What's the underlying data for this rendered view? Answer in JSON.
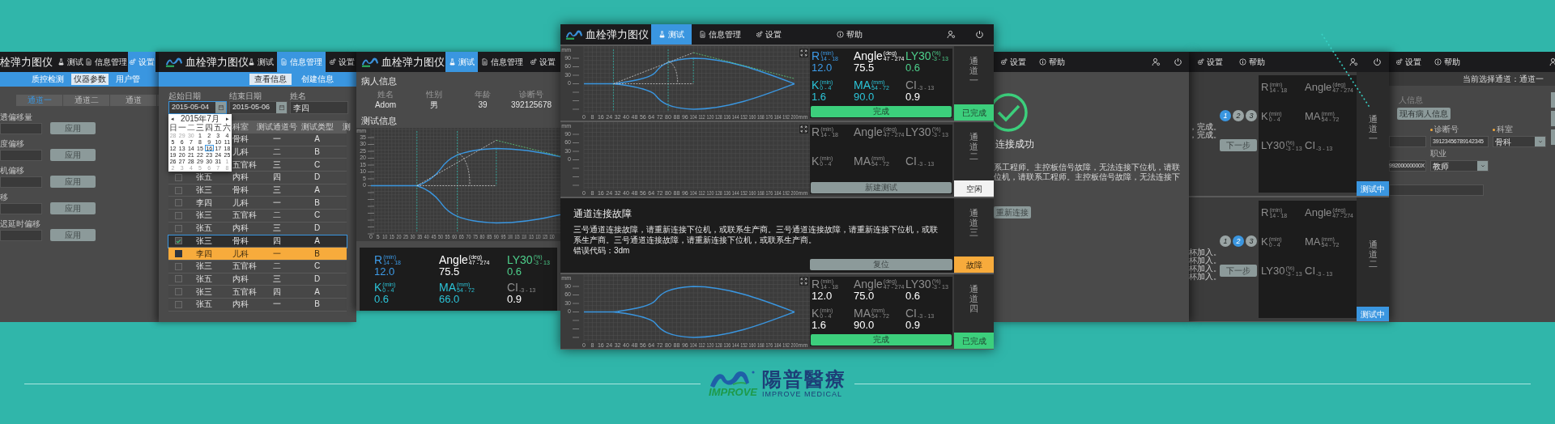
{
  "settings_window": {
    "title": "栓弹力图仪",
    "tabs": [
      {
        "label": "测试",
        "kind": "test",
        "selected": false
      },
      {
        "label": "信息管理",
        "kind": "records",
        "selected": false
      },
      {
        "label": "设置",
        "kind": "settings",
        "selected": true
      }
    ],
    "subtabs": [
      {
        "label": "质控检测",
        "selected": false
      },
      {
        "label": "仪器参数",
        "selected": true
      },
      {
        "label": "用户管",
        "selected": false
      }
    ],
    "channel_tabs": [
      {
        "label": "通道一",
        "selected": true
      },
      {
        "label": "通道二",
        "selected": false
      },
      {
        "label": "通道",
        "selected": false
      }
    ],
    "params": [
      {
        "label": "透偏移量",
        "button": "应用"
      },
      {
        "label": "度偏移",
        "button": "应用"
      },
      {
        "label": "机偏移",
        "button": "应用"
      },
      {
        "label": "移",
        "button": "应用"
      },
      {
        "label": "迟延时偏移",
        "button": "应用"
      }
    ]
  },
  "records_window": {
    "title": "血栓弹力图仪",
    "tabs": [
      {
        "label": "测试",
        "kind": "test",
        "selected": false
      },
      {
        "label": "信息管理",
        "kind": "records",
        "selected": true
      },
      {
        "label": "设置",
        "kind": "settings",
        "selected": false
      }
    ],
    "subtabs": [
      {
        "label": "查看信息",
        "selected": true
      },
      {
        "label": "创建信息",
        "selected": false
      }
    ],
    "filters": [
      {
        "label": "起始日期",
        "value": "2015-05-04",
        "kind": "date",
        "focused": true
      },
      {
        "label": "结束日期",
        "value": "2015-05-06",
        "kind": "date",
        "focused": false
      },
      {
        "label": "姓名",
        "value": "李四",
        "kind": "text",
        "focused": false
      }
    ],
    "calendar": {
      "title": "2015年7月",
      "prev": "◂",
      "next": "▸",
      "weekdays": [
        "日",
        "一",
        "二",
        "三",
        "四",
        "五",
        "六"
      ],
      "days": [
        {
          "day": "28",
          "muted": true,
          "selected": false
        },
        {
          "day": "29",
          "muted": true,
          "selected": false
        },
        {
          "day": "30",
          "muted": true,
          "selected": false
        },
        {
          "day": "1",
          "muted": false,
          "selected": false
        },
        {
          "day": "2",
          "muted": false,
          "selected": false
        },
        {
          "day": "3",
          "muted": false,
          "selected": false
        },
        {
          "day": "4",
          "muted": false,
          "selected": false
        },
        {
          "day": "5",
          "muted": false,
          "selected": false
        },
        {
          "day": "6",
          "muted": false,
          "selected": false
        },
        {
          "day": "7",
          "muted": false,
          "selected": false
        },
        {
          "day": "8",
          "muted": false,
          "selected": false
        },
        {
          "day": "9",
          "muted": false,
          "selected": false
        },
        {
          "day": "10",
          "muted": false,
          "selected": false
        },
        {
          "day": "11",
          "muted": false,
          "selected": false
        },
        {
          "day": "12",
          "muted": false,
          "selected": false
        },
        {
          "day": "13",
          "muted": false,
          "selected": false
        },
        {
          "day": "14",
          "muted": false,
          "selected": false
        },
        {
          "day": "15",
          "muted": false,
          "selected": false
        },
        {
          "day": "16",
          "muted": false,
          "selected": true
        },
        {
          "day": "17",
          "muted": false,
          "selected": false
        },
        {
          "day": "18",
          "muted": false,
          "selected": false
        },
        {
          "day": "19",
          "muted": false,
          "selected": false
        },
        {
          "day": "20",
          "muted": false,
          "selected": false
        },
        {
          "day": "21",
          "muted": false,
          "selected": false
        },
        {
          "day": "22",
          "muted": false,
          "selected": false
        },
        {
          "day": "23",
          "muted": false,
          "selected": false
        },
        {
          "day": "24",
          "muted": false,
          "selected": false
        },
        {
          "day": "25",
          "muted": false,
          "selected": false
        },
        {
          "day": "26",
          "muted": false,
          "selected": false
        },
        {
          "day": "27",
          "muted": false,
          "selected": false
        },
        {
          "day": "28",
          "muted": false,
          "selected": false
        },
        {
          "day": "29",
          "muted": false,
          "selected": false
        },
        {
          "day": "30",
          "muted": false,
          "selected": false
        },
        {
          "day": "31",
          "muted": false,
          "selected": false
        },
        {
          "day": "1",
          "muted": true,
          "selected": false
        },
        {
          "day": "2",
          "muted": true,
          "selected": false
        },
        {
          "day": "3",
          "muted": true,
          "selected": false
        },
        {
          "day": "4",
          "muted": true,
          "selected": false
        },
        {
          "day": "5",
          "muted": true,
          "selected": false
        },
        {
          "day": "6",
          "muted": true,
          "selected": false
        },
        {
          "day": "7",
          "muted": true,
          "selected": false
        },
        {
          "day": "8",
          "muted": true,
          "selected": false
        }
      ]
    },
    "table": {
      "columns": [
        "科室",
        "测试通道号",
        "测试类型",
        "测"
      ],
      "rows": [
        {
          "dept": "骨科",
          "channel": "一",
          "type": "A",
          "selected": false
        },
        {
          "dept": "儿科",
          "channel": "二",
          "type": "B",
          "selected": false
        },
        {
          "dept": "五官科",
          "channel": "三",
          "type": "C",
          "selected": false
        },
        {
          "checked": false,
          "name": "张五",
          "dept": "内科",
          "channel": "四",
          "type": "D",
          "selected": false
        },
        {
          "checked": false,
          "name": "张三",
          "dept": "骨科",
          "channel": "三",
          "type": "A",
          "selected": false
        },
        {
          "checked": false,
          "name": "李四",
          "dept": "儿科",
          "channel": "一",
          "type": "B",
          "selected": false
        },
        {
          "checked": false,
          "name": "张三",
          "dept": "五官科",
          "channel": "二",
          "type": "C",
          "selected": false
        },
        {
          "checked": false,
          "name": "张五",
          "dept": "内科",
          "channel": "三",
          "type": "D",
          "selected": false
        },
        {
          "checked": true,
          "name": "张三",
          "dept": "骨科",
          "channel": "四",
          "type": "A",
          "selected": false
        },
        {
          "checked": false,
          "name": "李四",
          "dept": "儿科",
          "channel": "一",
          "type": "B",
          "selected": true
        },
        {
          "checked": false,
          "name": "张三",
          "dept": "五官科",
          "channel": "二",
          "type": "C",
          "selected": false
        },
        {
          "checked": false,
          "name": "张五",
          "dept": "内科",
          "channel": "三",
          "type": "D",
          "selected": false
        },
        {
          "checked": false,
          "name": "张三",
          "dept": "五官科",
          "channel": "四",
          "type": "A",
          "selected": false
        },
        {
          "checked": false,
          "name": "张五",
          "dept": "内科",
          "channel": "一",
          "type": "B",
          "selected": false
        }
      ]
    }
  },
  "patient_window": {
    "title": "血栓弹力图仪",
    "tabs": [
      {
        "label": "测试",
        "kind": "test",
        "selected": true
      },
      {
        "label": "信息管理",
        "kind": "records",
        "selected": false
      },
      {
        "label": "设置",
        "kind": "settings",
        "selected": false
      }
    ],
    "patient_heading": "病人信息",
    "patient_fields": [
      {
        "label": "姓名",
        "value": "Adom"
      },
      {
        "label": "性别",
        "value": "男"
      },
      {
        "label": "年龄",
        "value": "39"
      },
      {
        "label": "诊断号",
        "value": "392125678"
      }
    ],
    "test_heading": "测试信息",
    "chart": {
      "curve": true,
      "guides": true,
      "y_unit": "mm",
      "y_ticks": [
        "35",
        "30",
        "25",
        "20",
        "15",
        "10",
        "5",
        "0"
      ],
      "x_ticks": [
        "0",
        "5",
        "10",
        "15",
        "20",
        "25",
        "30",
        "35",
        "40",
        "45",
        "50",
        "55",
        "60",
        "65",
        "70",
        "75",
        "80",
        "85",
        "90",
        "95",
        "100",
        "105",
        "110",
        "115",
        "120",
        "125",
        "130"
      ]
    },
    "metrics": [
      {
        "name": "R",
        "unit": "(min)",
        "range": "14 - 18",
        "value": "12.0",
        "color": "#3d9be8",
        "value_highlighted": true
      },
      {
        "name": "Angle",
        "unit": "(deg)",
        "range": "47 - 274",
        "value": "75.5",
        "color": "#ffffff"
      },
      {
        "name": "LY30",
        "unit": "(%)",
        "range": "-3 - 13",
        "value": "0.6",
        "color": "#4ed08c",
        "value_highlighted": true
      },
      {
        "name": "K",
        "unit": "(min)",
        "range": "0 - 4",
        "value": "0.6",
        "color": "#2cc4d8",
        "value_highlighted": true
      },
      {
        "name": "MA",
        "unit": "(mm)",
        "range": "54 - 72",
        "value": "66.0",
        "color": "#2cc4d8",
        "value_highlighted": true
      },
      {
        "name": "CI",
        "range": "-3 - 13",
        "value": "0.9",
        "color": "#8e8e8e",
        "value_highlighted": false
      }
    ]
  },
  "main_window": {
    "title": "血栓弹力图仪",
    "tabs": [
      {
        "label": "测试",
        "kind": "test",
        "selected": true
      },
      {
        "label": "信息管理",
        "kind": "records",
        "selected": false
      },
      {
        "label": "设置",
        "kind": "settings",
        "selected": false
      },
      {
        "label": "帮助",
        "kind": "help",
        "selected": false
      }
    ],
    "channels": [
      {
        "kind": "result",
        "chart": {
          "curve": true,
          "guides": true,
          "y_unit": "mm",
          "y_ticks": [
            "90",
            "60",
            "30",
            "0"
          ],
          "x_ticks": [
            "0",
            "8",
            "16",
            "24",
            "32",
            "40",
            "48",
            "56",
            "64",
            "72",
            "80",
            "88",
            "96",
            "104",
            "112",
            "120",
            "128",
            "136",
            "144",
            "152",
            "160",
            "168",
            "176",
            "184",
            "192",
            "200"
          ],
          "x_unit": "mm"
        },
        "metrics": [
          {
            "name": "R",
            "unit": "(min)",
            "range": "14 - 18",
            "value": "12.0",
            "color": "#3d9be8",
            "value_highlighted": true
          },
          {
            "name": "Angle",
            "unit": "(deg)",
            "range": "47 - 274",
            "value": "75.5",
            "color": "#ffffff"
          },
          {
            "name": "LY30",
            "unit": "(%)",
            "range": "-3 - 13",
            "value": "0.6",
            "color": "#4ed08c",
            "value_highlighted": true
          },
          {
            "name": "K",
            "unit": "(min)",
            "range": "0 - 4",
            "value": "1.6",
            "color": "#2cc4d8",
            "value_highlighted": true
          },
          {
            "name": "MA",
            "unit": "(mm)",
            "range": "54 - 72",
            "value": "90.0",
            "color": "#2cc4d8",
            "value_highlighted": true
          },
          {
            "name": "CI",
            "range": "-3 - 13",
            "value": "0.9",
            "color": "#8e8e8e",
            "value_highlighted": false
          }
        ],
        "button": {
          "label": "完成",
          "kind": "done"
        },
        "channel": "通道一",
        "status": {
          "label": "已完成",
          "kind": "done"
        }
      },
      {
        "kind": "result",
        "chart": {
          "curve": false,
          "guides": false,
          "y_unit": "mm",
          "y_ticks": [
            "90",
            "60",
            "30",
            "0"
          ],
          "x_ticks": [
            "0",
            "8",
            "16",
            "24",
            "32",
            "40",
            "48",
            "56",
            "64",
            "72",
            "80",
            "88",
            "96",
            "104",
            "112",
            "120",
            "128",
            "136",
            "144",
            "152",
            "160",
            "168",
            "176",
            "184",
            "192",
            "200"
          ],
          "x_unit": "mm"
        },
        "metrics": [
          {
            "name": "R",
            "unit": "(min)",
            "range": "14 - 18",
            "color": "#8e8e8e"
          },
          {
            "name": "Angle",
            "unit": "(deg)",
            "range": "47 - 274",
            "color": "#8e8e8e"
          },
          {
            "name": "LY30",
            "unit": "(%)",
            "range": "-3 - 13",
            "color": "#8e8e8e"
          },
          {
            "name": "K",
            "unit": "(min)",
            "range": "0 - 4",
            "color": "#8e8e8e"
          },
          {
            "name": "MA",
            "unit": "(mm)",
            "range": "54 - 72",
            "color": "#8e8e8e"
          },
          {
            "name": "CI",
            "range": "-3 - 13",
            "color": "#8e8e8e"
          }
        ],
        "button": {
          "label": "新建测试",
          "kind": "neutral"
        },
        "channel": "通道二",
        "status": {
          "label": "空闲",
          "kind": "idle"
        }
      },
      {
        "kind": "fault",
        "title": "通道连接故障",
        "message": "三号通道连接故障，请重新连接下位机，或联系生产商。三号通道连接故障，请重新连接下位机，或联系生产商。三号通道连接故障，请重新连接下位机，或联系生产商。",
        "error": "错误代码：3dm",
        "button": {
          "label": "复位",
          "kind": "neutral"
        },
        "channel": "通道三",
        "status": {
          "label": "故障",
          "kind": "fault"
        }
      },
      {
        "kind": "result",
        "chart": {
          "curve": true,
          "guides": false,
          "y_unit": "mm",
          "y_ticks": [
            "90",
            "60",
            "30",
            "0"
          ],
          "x_ticks": [
            "0",
            "8",
            "16",
            "24",
            "32",
            "40",
            "48",
            "56",
            "64",
            "72",
            "80",
            "88",
            "96",
            "104",
            "112",
            "120",
            "128",
            "136",
            "144",
            "152",
            "160",
            "168",
            "176",
            "184",
            "192",
            "200"
          ],
          "x_unit": "mm"
        },
        "metrics": [
          {
            "name": "R",
            "unit": "(min)",
            "range": "14 - 18",
            "value": "12.0",
            "color": "#8e8e8e",
            "value_highlighted": false
          },
          {
            "name": "Angle",
            "unit": "(deg)",
            "range": "47 - 274",
            "value": "75.0",
            "color": "#8e8e8e",
            "value_highlighted": false
          },
          {
            "name": "LY30",
            "unit": "(%)",
            "range": "-3 - 13",
            "value": "0.6",
            "color": "#8e8e8e",
            "value_highlighted": false
          },
          {
            "name": "K",
            "unit": "(min)",
            "range": "0 - 4",
            "value": "1.6",
            "color": "#8e8e8e",
            "value_highlighted": false
          },
          {
            "name": "MA",
            "unit": "(mm)",
            "range": "54 - 72",
            "value": "90.0",
            "color": "#8e8e8e",
            "value_highlighted": false
          },
          {
            "name": "CI",
            "range": "-3 - 13",
            "value": "0.9",
            "color": "#8e8e8e",
            "value_highlighted": false
          }
        ],
        "button": {
          "label": "完成",
          "kind": "done"
        },
        "channel": "通道四",
        "status": {
          "label": "已完成",
          "kind": "done"
        }
      }
    ]
  },
  "connection_window": {
    "tabs": [
      {
        "label": "设置",
        "kind": "settings",
        "selected": false
      },
      {
        "label": "帮助",
        "kind": "help",
        "selected": false
      }
    ],
    "title": "连接成功",
    "message_lines": [
      "系工程师。主控板信号故障，无法连接下位机，请联",
      "位机，请联系工程师。主控板信号故障，无法连接下"
    ],
    "button": "重新连接"
  },
  "steps_window": {
    "tabs": [
      {
        "label": "设置",
        "kind": "settings",
        "selected": false
      },
      {
        "label": "帮助",
        "kind": "help",
        "selected": false
      }
    ],
    "panels": [
      {
        "notes": [
          "，完成。",
          "，完成。"
        ],
        "steps": [
          {
            "label": "1",
            "selected": true
          },
          {
            "label": "2",
            "selected": false
          },
          {
            "label": "3",
            "selected": false
          }
        ],
        "button": "下一步",
        "metrics": [
          {
            "name": "R",
            "unit": "(min)",
            "range": "14 - 18",
            "color": "#8e8e8e"
          },
          {
            "name": "Angle",
            "unit": "(deg)",
            "range": "47 - 274",
            "color": "#8e8e8e"
          },
          {
            "name": "K",
            "unit": "(min)",
            "range": "0 - 4",
            "color": "#8e8e8e"
          },
          {
            "name": "MA",
            "unit": "(mm)",
            "range": "54 - 72",
            "color": "#8e8e8e"
          },
          {
            "name": "LY30",
            "unit": "(%)",
            "range": "-3 - 13",
            "color": "#8e8e8e"
          },
          {
            "name": "CI",
            "range": "-3 - 13",
            "color": "#8e8e8e"
          }
        ],
        "channel": "通道一",
        "status": {
          "label": "测试中",
          "kind": "testing"
        }
      },
      {
        "notes": [
          "杯加入。",
          "杯加入。",
          "杯加入。",
          "杯加入。"
        ],
        "steps": [
          {
            "label": "1",
            "selected": false
          },
          {
            "label": "2",
            "selected": true
          },
          {
            "label": "3",
            "selected": false
          }
        ],
        "button": "下一步",
        "metrics": [
          {
            "name": "R",
            "unit": "(min)",
            "range": "14 - 18",
            "color": "#8e8e8e"
          },
          {
            "name": "Angle",
            "unit": "(deg)",
            "range": "47 - 274",
            "color": "#8e8e8e"
          },
          {
            "name": "K",
            "unit": "(min)",
            "range": "0 - 4",
            "color": "#8e8e8e"
          },
          {
            "name": "MA",
            "unit": "(mm)",
            "range": "54 - 72",
            "color": "#8e8e8e"
          },
          {
            "name": "LY30",
            "unit": "(%)",
            "range": "-3 - 13",
            "color": "#8e8e8e"
          },
          {
            "name": "CI",
            "range": "-3 - 13",
            "color": "#8e8e8e"
          }
        ],
        "channel": "通道二",
        "status": {
          "label": "测试中",
          "kind": "testing"
        }
      }
    ]
  },
  "patient_form_window": {
    "tabs": [
      {
        "label": "设置",
        "kind": "settings",
        "selected": false
      },
      {
        "label": "帮助",
        "kind": "help",
        "selected": false
      }
    ],
    "channel_note": "当前选择通道：通道一",
    "section": "人信息",
    "existing_button": "现有病人信息",
    "fields": [
      {
        "label": "诊断号",
        "required": true,
        "value": "39123456789142345",
        "kind": "text"
      },
      {
        "label": "科室",
        "required": true,
        "value": "骨科",
        "kind": "select"
      },
      {
        "label": "职业",
        "required": false,
        "value": "教师",
        "kind": "select"
      }
    ],
    "id_value": "99200000000X"
  },
  "brand": {
    "wordmark": "IMPROVE",
    "name_zh": "陽普醫療",
    "name_en": "IMPROVE MEDICAL"
  }
}
